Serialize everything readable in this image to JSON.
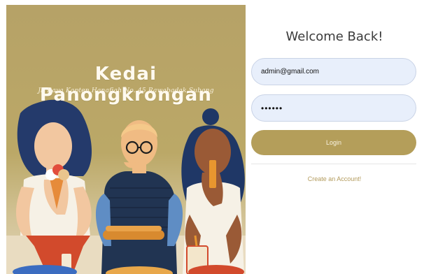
{
  "brand": {
    "name": "Kedai Panongkrongan",
    "address": "Jl. Raya Kapten Hanafiah No. 45 Rawabadak Subang"
  },
  "login_form": {
    "heading": "Welcome Back!",
    "email_value": "admin@gmail.com",
    "password_value": "••••••",
    "login_label": "Login",
    "create_account_label": "Create an Account!"
  },
  "colors": {
    "accent": "#b49e5a",
    "input_background": "#e8effb",
    "hero_background": "#b6a267"
  },
  "icons": [
    "woman-eating-ice-cream-illustration",
    "man-with-glasses-eating-illustration",
    "woman-drinking-illustration"
  ]
}
